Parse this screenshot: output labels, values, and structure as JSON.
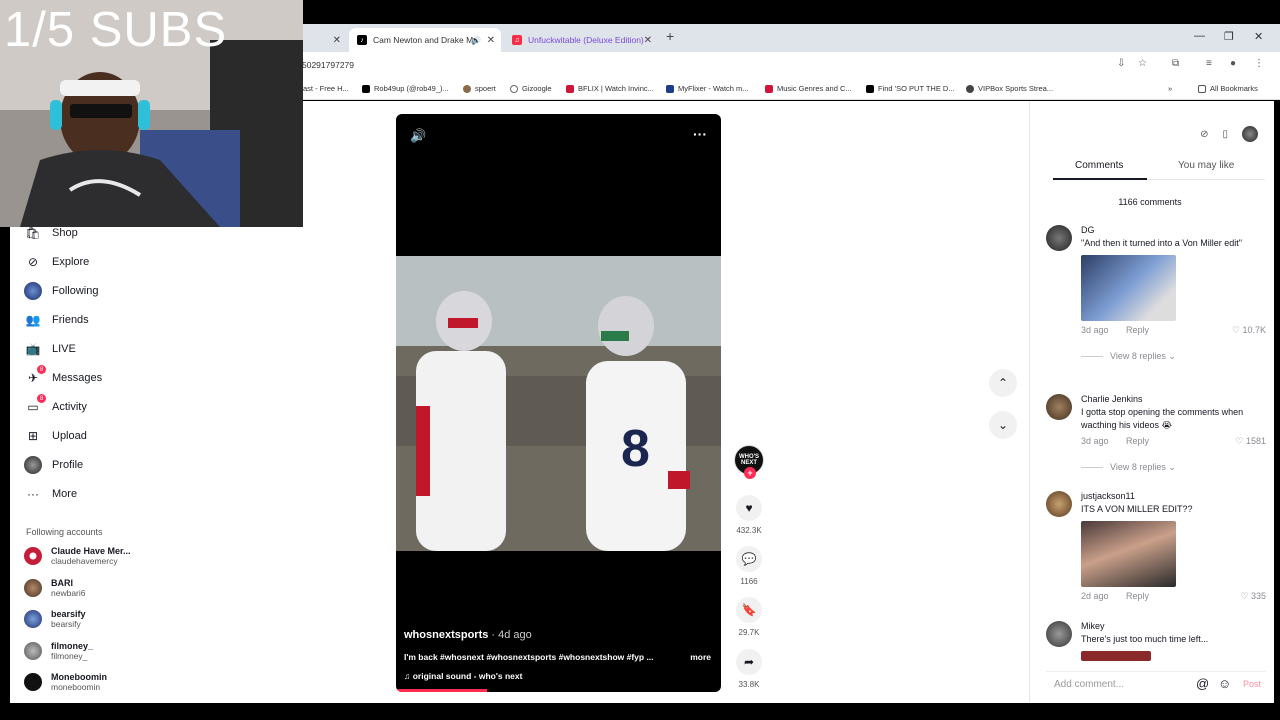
{
  "browser": {
    "tabs": [
      {
        "title": "Cam Newton and Drake M",
        "active": true
      },
      {
        "title": "Unfuckwitable (Deluxe Edition)",
        "active": false
      }
    ],
    "url": "50291797279",
    "bookmarks": [
      "ast - Free H...",
      "Rob49up (@rob49_)...",
      "spoert",
      "Gizoogle",
      "BFLIX | Watch Invinc...",
      "MyFlixer - Watch m...",
      "Music Genres and C...",
      "Find 'SO PUT THE D...",
      "VIPBox Sports Strea..."
    ],
    "all_bookmarks": "All Bookmarks"
  },
  "sidebar": {
    "items": [
      {
        "label": "Shop",
        "icon": "shop-icon"
      },
      {
        "label": "Explore",
        "icon": "compass-icon"
      },
      {
        "label": "Following",
        "icon": "following-avatar-icon"
      },
      {
        "label": "Friends",
        "icon": "friends-icon"
      },
      {
        "label": "LIVE",
        "icon": "live-icon"
      },
      {
        "label": "Messages",
        "icon": "messages-icon",
        "badge": "8"
      },
      {
        "label": "Activity",
        "icon": "activity-icon",
        "badge": "8"
      },
      {
        "label": "Upload",
        "icon": "upload-icon"
      },
      {
        "label": "Profile",
        "icon": "profile-avatar-icon"
      },
      {
        "label": "More",
        "icon": "more-icon"
      }
    ],
    "following_title": "Following accounts",
    "accounts": [
      {
        "name": "Claude Have Mer...",
        "handle": "claudehavemercy"
      },
      {
        "name": "BARI",
        "handle": "newbari6"
      },
      {
        "name": "bearsify",
        "handle": "bearsify"
      },
      {
        "name": "filmoney_",
        "handle": "filmoney_"
      },
      {
        "name": "Moneboomin",
        "handle": "moneboomin"
      }
    ]
  },
  "video": {
    "username": "whosnextsports",
    "time": " · 4d ago",
    "description": "I'm back #whosnext #whosnextsports #whosnextshow #fyp ...",
    "more": "more",
    "sound": "♫  original sound - who's next",
    "author_avatar_text": "WHO'S NEXT",
    "likes": "432.3K",
    "comments": "1166",
    "saves": "29.7K",
    "shares": "33.8K",
    "progress": 0.28
  },
  "comments_panel": {
    "tabs": [
      "Comments",
      "You may like"
    ],
    "count_label": "1166 comments",
    "comments": [
      {
        "user": "DG",
        "text": "\"And then it turned into a Von Miller edit\"",
        "ago": "3d ago",
        "reply": "Reply",
        "likes": "10.7K",
        "replies": "View 8 replies ⌄",
        "has_image": true
      },
      {
        "user": "Charlie Jenkins",
        "text": "I gotta stop opening the comments when wacthing his videos 😭",
        "ago": "3d ago",
        "reply": "Reply",
        "likes": "1581",
        "replies": "View 8 replies ⌄",
        "has_image": false
      },
      {
        "user": "justjackson11",
        "text": "ITS A VON MILLER EDIT??",
        "ago": "2d ago",
        "reply": "Reply",
        "likes": "335",
        "replies": "",
        "has_image": true
      },
      {
        "user": "Mikey",
        "text": "There's just too much time left...",
        "ago": "",
        "reply": "",
        "likes": "",
        "replies": "",
        "has_image": false
      }
    ],
    "add_placeholder": "Add comment...",
    "post": "Post"
  },
  "overlay": {
    "title": "1/5 SUBS"
  },
  "colors": {
    "accent": "#fe2c55",
    "text": "#161823",
    "muted": "#8a8b91"
  }
}
